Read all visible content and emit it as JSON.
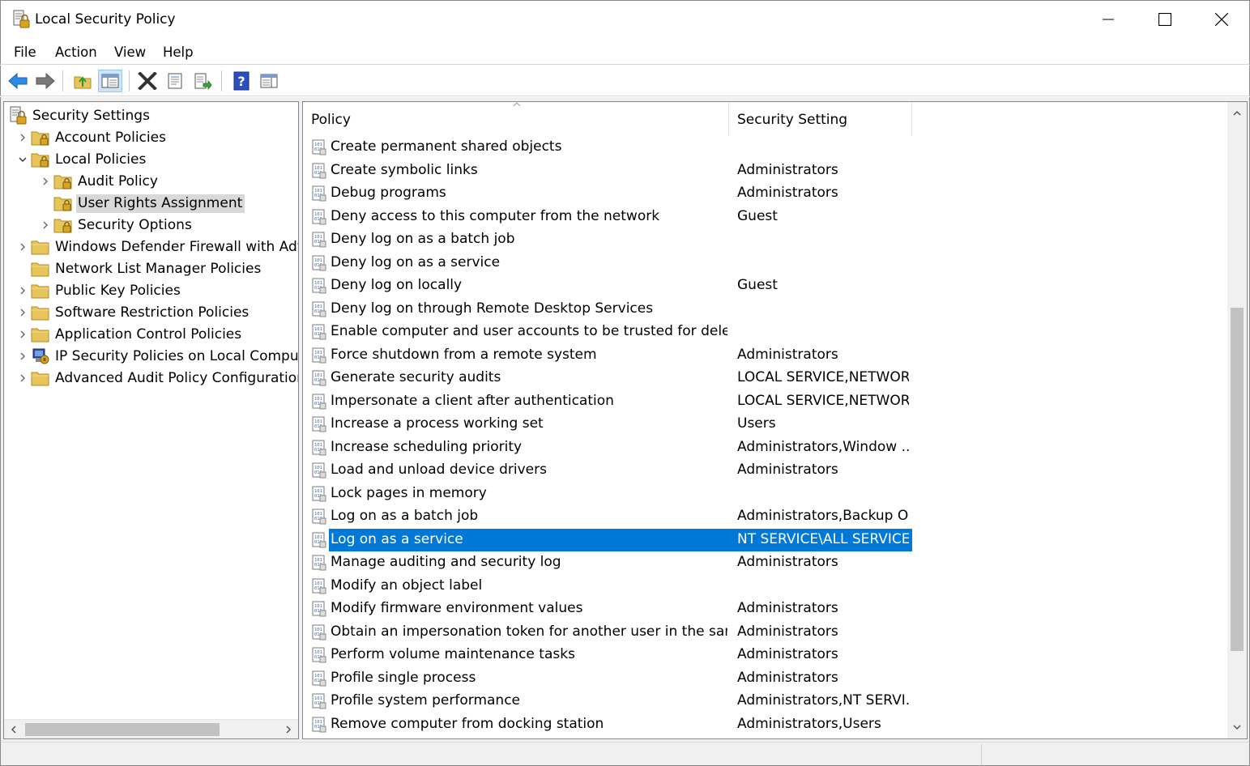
{
  "window": {
    "title": "Local Security Policy",
    "icon": "security-policy-icon"
  },
  "menu": {
    "items": [
      "File",
      "Action",
      "View",
      "Help"
    ]
  },
  "toolbar": {
    "buttons": [
      "back-arrow-icon",
      "forward-arrow-icon",
      "up-folder-icon",
      "show-hide-tree-icon",
      "delete-icon",
      "properties-icon",
      "export-list-icon",
      "help-icon",
      "show-hide-action-pane-icon"
    ]
  },
  "tree": {
    "root": "Security Settings",
    "items": [
      {
        "label": "Account Policies",
        "level": 1,
        "expander": "collapsed"
      },
      {
        "label": "Local Policies",
        "level": 1,
        "expander": "expanded"
      },
      {
        "label": "Audit Policy",
        "level": 2,
        "expander": "collapsed"
      },
      {
        "label": "User Rights Assignment",
        "level": 2,
        "expander": "none",
        "selected": true
      },
      {
        "label": "Security Options",
        "level": 2,
        "expander": "collapsed"
      },
      {
        "label": "Windows Defender Firewall with Advanced Security",
        "level": 1,
        "expander": "collapsed"
      },
      {
        "label": "Network List Manager Policies",
        "level": 1,
        "expander": "none"
      },
      {
        "label": "Public Key Policies",
        "level": 1,
        "expander": "collapsed"
      },
      {
        "label": "Software Restriction Policies",
        "level": 1,
        "expander": "collapsed"
      },
      {
        "label": "Application Control Policies",
        "level": 1,
        "expander": "collapsed"
      },
      {
        "label": "IP Security Policies on Local Computer",
        "level": 1,
        "expander": "collapsed"
      },
      {
        "label": "Advanced Audit Policy Configuration",
        "level": 1,
        "expander": "collapsed"
      }
    ]
  },
  "list": {
    "columns": {
      "policy": "Policy",
      "setting": "Security Setting"
    },
    "rows": [
      {
        "policy": "Create permanent shared objects",
        "setting": ""
      },
      {
        "policy": "Create symbolic links",
        "setting": "Administrators"
      },
      {
        "policy": "Debug programs",
        "setting": "Administrators"
      },
      {
        "policy": "Deny access to this computer from the network",
        "setting": "Guest"
      },
      {
        "policy": "Deny log on as a batch job",
        "setting": ""
      },
      {
        "policy": "Deny log on as a service",
        "setting": ""
      },
      {
        "policy": "Deny log on locally",
        "setting": "Guest"
      },
      {
        "policy": "Deny log on through Remote Desktop Services",
        "setting": ""
      },
      {
        "policy": "Enable computer and user accounts to be trusted for delegati...",
        "setting": ""
      },
      {
        "policy": "Force shutdown from a remote system",
        "setting": "Administrators"
      },
      {
        "policy": "Generate security audits",
        "setting": "LOCAL SERVICE,NETWOR..."
      },
      {
        "policy": "Impersonate a client after authentication",
        "setting": "LOCAL SERVICE,NETWOR..."
      },
      {
        "policy": "Increase a process working set",
        "setting": "Users"
      },
      {
        "policy": "Increase scheduling priority",
        "setting": "Administrators,Window ..."
      },
      {
        "policy": "Load and unload device drivers",
        "setting": "Administrators"
      },
      {
        "policy": "Lock pages in memory",
        "setting": ""
      },
      {
        "policy": "Log on as a batch job",
        "setting": "Administrators,Backup O..."
      },
      {
        "policy": "Log on as a service",
        "setting": "NT SERVICE\\ALL SERVICE...",
        "selected": true
      },
      {
        "policy": "Manage auditing and security log",
        "setting": "Administrators"
      },
      {
        "policy": "Modify an object label",
        "setting": ""
      },
      {
        "policy": "Modify firmware environment values",
        "setting": "Administrators"
      },
      {
        "policy": "Obtain an impersonation token for another user in the same ...",
        "setting": "Administrators"
      },
      {
        "policy": "Perform volume maintenance tasks",
        "setting": "Administrators"
      },
      {
        "policy": "Profile single process",
        "setting": "Administrators"
      },
      {
        "policy": "Profile system performance",
        "setting": "Administrators,NT SERVI..."
      },
      {
        "policy": "Remove computer from docking station",
        "setting": "Administrators,Users"
      }
    ]
  },
  "colors": {
    "selection": "#0078d7",
    "tree_selection": "#d9d9d9",
    "folder": "#e8c55a"
  }
}
